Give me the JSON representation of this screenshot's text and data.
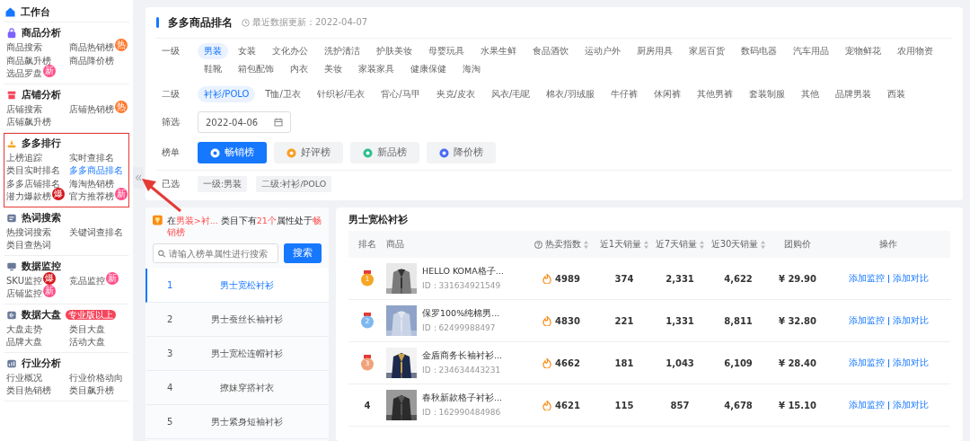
{
  "sidebar": {
    "home": {
      "label": "工作台"
    },
    "sections": [
      {
        "title": "商品分析",
        "color": "#7b61ff",
        "highlighted": false,
        "items": [
          {
            "label": "商品搜索",
            "selected": false
          },
          {
            "label": "商品热销榜",
            "selected": false,
            "badge": {
              "text": "热",
              "color": "#ff7a2f"
            }
          },
          {
            "label": "商品飙升榜",
            "selected": false
          },
          {
            "label": "商品降价榜",
            "selected": false
          },
          {
            "label": "选品罗盘",
            "selected": false,
            "badge": {
              "text": "新",
              "color": "#ff4f8b"
            }
          }
        ]
      },
      {
        "title": "店铺分析",
        "color": "#f5455c",
        "highlighted": false,
        "items": [
          {
            "label": "店铺搜索",
            "selected": false
          },
          {
            "label": "店铺热销榜",
            "selected": false,
            "badge": {
              "text": "热",
              "color": "#ff7a2f"
            }
          },
          {
            "label": "店铺飙升榜",
            "selected": false
          }
        ]
      },
      {
        "title": "多多排行",
        "color": "#f5a623",
        "highlighted": true,
        "items": [
          {
            "label": "上榜追踪",
            "selected": false
          },
          {
            "label": "实时查排名",
            "selected": false
          },
          {
            "label": "类目实时排名",
            "selected": false
          },
          {
            "label": "多多商品排名",
            "selected": true
          },
          {
            "label": "多多店铺排名",
            "selected": false
          },
          {
            "label": "海淘热销榜",
            "selected": false
          },
          {
            "label": "潜力爆款榜",
            "selected": false,
            "badge": {
              "text": "爆",
              "color": "#d4161c"
            }
          },
          {
            "label": "官方推荐榜",
            "selected": false,
            "badge": {
              "text": "新",
              "color": "#ff4f8b"
            }
          }
        ]
      },
      {
        "title": "热词搜索",
        "color": "#6b7a99",
        "highlighted": false,
        "items": [
          {
            "label": "热搜词搜索",
            "selected": false
          },
          {
            "label": "关键词查排名",
            "selected": false
          },
          {
            "label": "类目查热词",
            "selected": false
          }
        ]
      },
      {
        "title": "数据监控",
        "color": "#6b7a99",
        "highlighted": false,
        "items": [
          {
            "label": "SKU监控",
            "selected": false,
            "badge": {
              "text": "爆",
              "color": "#d4161c"
            }
          },
          {
            "label": "竞品监控",
            "selected": false,
            "badge": {
              "text": "新",
              "color": "#ff4f8b"
            }
          },
          {
            "label": "店铺监控",
            "selected": false,
            "badge": {
              "text": "新",
              "color": "#ff4f8b"
            }
          }
        ]
      },
      {
        "title": "数据大盘",
        "color": "#6b7a99",
        "highlighted": false,
        "tag": "专业版以上",
        "items": [
          {
            "label": "大盘走势",
            "selected": false
          },
          {
            "label": "类目大盘",
            "selected": false
          },
          {
            "label": "品牌大盘",
            "selected": false
          },
          {
            "label": "活动大盘",
            "selected": false
          }
        ]
      },
      {
        "title": "行业分析",
        "color": "#6b7a99",
        "highlighted": false,
        "items": [
          {
            "label": "行业概况",
            "selected": false
          },
          {
            "label": "行业价格动向",
            "selected": false
          },
          {
            "label": "类目热销榜",
            "selected": false
          },
          {
            "label": "类目飙升榜",
            "selected": false
          }
        ]
      }
    ]
  },
  "header": {
    "title": "多多商品排名",
    "updated": "最近数据更新：2022-04-07"
  },
  "filters": [
    {
      "label": "一级",
      "options": [
        {
          "label": "男装",
          "selected": true
        },
        {
          "label": "女装",
          "selected": false
        },
        {
          "label": "文化办公",
          "selected": false
        },
        {
          "label": "洗护清洁",
          "selected": false
        },
        {
          "label": "护肤美妆",
          "selected": false
        },
        {
          "label": "母婴玩具",
          "selected": false
        },
        {
          "label": "水果生鲜",
          "selected": false
        },
        {
          "label": "食品酒饮",
          "selected": false
        },
        {
          "label": "运动户外",
          "selected": false
        },
        {
          "label": "厨房用具",
          "selected": false
        },
        {
          "label": "家居百货",
          "selected": false
        },
        {
          "label": "数码电器",
          "selected": false
        },
        {
          "label": "汽车用品",
          "selected": false
        },
        {
          "label": "宠物鲜花",
          "selected": false
        },
        {
          "label": "农用物资",
          "selected": false
        },
        {
          "label": "鞋靴",
          "selected": false
        },
        {
          "label": "箱包配饰",
          "selected": false
        },
        {
          "label": "内衣",
          "selected": false
        },
        {
          "label": "美妆",
          "selected": false
        },
        {
          "label": "家装家具",
          "selected": false
        },
        {
          "label": "健康保健",
          "selected": false
        },
        {
          "label": "海淘",
          "selected": false
        }
      ]
    },
    {
      "label": "二级",
      "options": [
        {
          "label": "衬衫/POLO",
          "selected": true
        },
        {
          "label": "T恤/卫衣",
          "selected": false
        },
        {
          "label": "针织衫/毛衣",
          "selected": false
        },
        {
          "label": "背心/马甲",
          "selected": false
        },
        {
          "label": "夹克/皮衣",
          "selected": false
        },
        {
          "label": "风衣/毛呢",
          "selected": false
        },
        {
          "label": "棉衣/羽绒服",
          "selected": false
        },
        {
          "label": "牛仔裤",
          "selected": false
        },
        {
          "label": "休闲裤",
          "selected": false
        },
        {
          "label": "其他男裤",
          "selected": false
        },
        {
          "label": "套装制服",
          "selected": false
        },
        {
          "label": "其他",
          "selected": false
        },
        {
          "label": "品牌男装",
          "selected": false
        },
        {
          "label": "西装",
          "selected": false
        }
      ]
    }
  ],
  "date_filter": {
    "label": "筛选",
    "value": "2022-04-06"
  },
  "lists": {
    "label": "榜单",
    "options": [
      {
        "label": "畅销榜",
        "selected": true,
        "color": "#1677ff"
      },
      {
        "label": "好评榜",
        "selected": false,
        "color": "#fa9d1e"
      },
      {
        "label": "新品榜",
        "selected": false,
        "color": "#2ebf8a"
      },
      {
        "label": "降价榜",
        "selected": false,
        "color": "#4a6cf7"
      }
    ]
  },
  "chosen": {
    "label": "已选",
    "tags": [
      "一级:男装",
      "二级:衬衫/POLO"
    ]
  },
  "attributes": {
    "notice": "在**男装>衬...** 类目下有**21个**属性处于**畅销榜**",
    "search": {
      "placeholder": "请输入榜单属性进行搜索",
      "button": "搜索"
    },
    "items": [
      {
        "rank": "1",
        "label": "男士宽松衬衫",
        "selected": true
      },
      {
        "rank": "2",
        "label": "男士蚕丝长袖衬衫",
        "selected": false
      },
      {
        "rank": "3",
        "label": "男士宽松连帽衬衫",
        "selected": false
      },
      {
        "rank": "4",
        "label": "撩妹穿搭衬衣",
        "selected": false
      },
      {
        "rank": "5",
        "label": "男士紧身短袖衬衫",
        "selected": false
      }
    ]
  },
  "table": {
    "title": "男士宽松衬衫",
    "columns": [
      "排名",
      "商品",
      "热卖指数",
      "近1天销量",
      "近7天销量",
      "近30天销量",
      "团购价",
      "操作"
    ],
    "rows": [
      {
        "rank": "1",
        "kind": "medal",
        "color": "#f5a623",
        "image": {
          "kind": "picture"
        },
        "name": "HELLO KOMA格子...",
        "id": "ID：331634921549",
        "hot": "4989",
        "d1": "374",
        "d7": "2,331",
        "d30": "4,622",
        "price": "¥ 29.90",
        "actions": [
          "添加监控",
          "添加对比"
        ]
      },
      {
        "rank": "2",
        "kind": "medal",
        "color": "#7fb8f0",
        "image": {
          "kind": "picture"
        },
        "name": "保罗100%纯棉男...",
        "id": "ID：62499988497",
        "hot": "4830",
        "d1": "221",
        "d7": "1,331",
        "d30": "8,811",
        "price": "¥ 32.80",
        "actions": [
          "添加监控",
          "添加对比"
        ]
      },
      {
        "rank": "3",
        "kind": "medal",
        "color": "#f0a37a",
        "image": {
          "kind": "picture"
        },
        "name": "金盾商务长袖衬衫...",
        "id": "ID：234634443231",
        "hot": "4662",
        "d1": "181",
        "d7": "1,043",
        "d30": "6,109",
        "price": "¥ 28.40",
        "actions": [
          "添加监控",
          "添加对比"
        ]
      },
      {
        "rank": "4",
        "kind": "plain",
        "image": {
          "kind": "picture"
        },
        "name": "春秋新款格子衬衫...",
        "id": "ID：162990484986",
        "hot": "4621",
        "d1": "115",
        "d7": "857",
        "d30": "4,678",
        "price": "¥ 15.10",
        "actions": [
          "添加监控",
          "添加对比"
        ]
      }
    ]
  }
}
